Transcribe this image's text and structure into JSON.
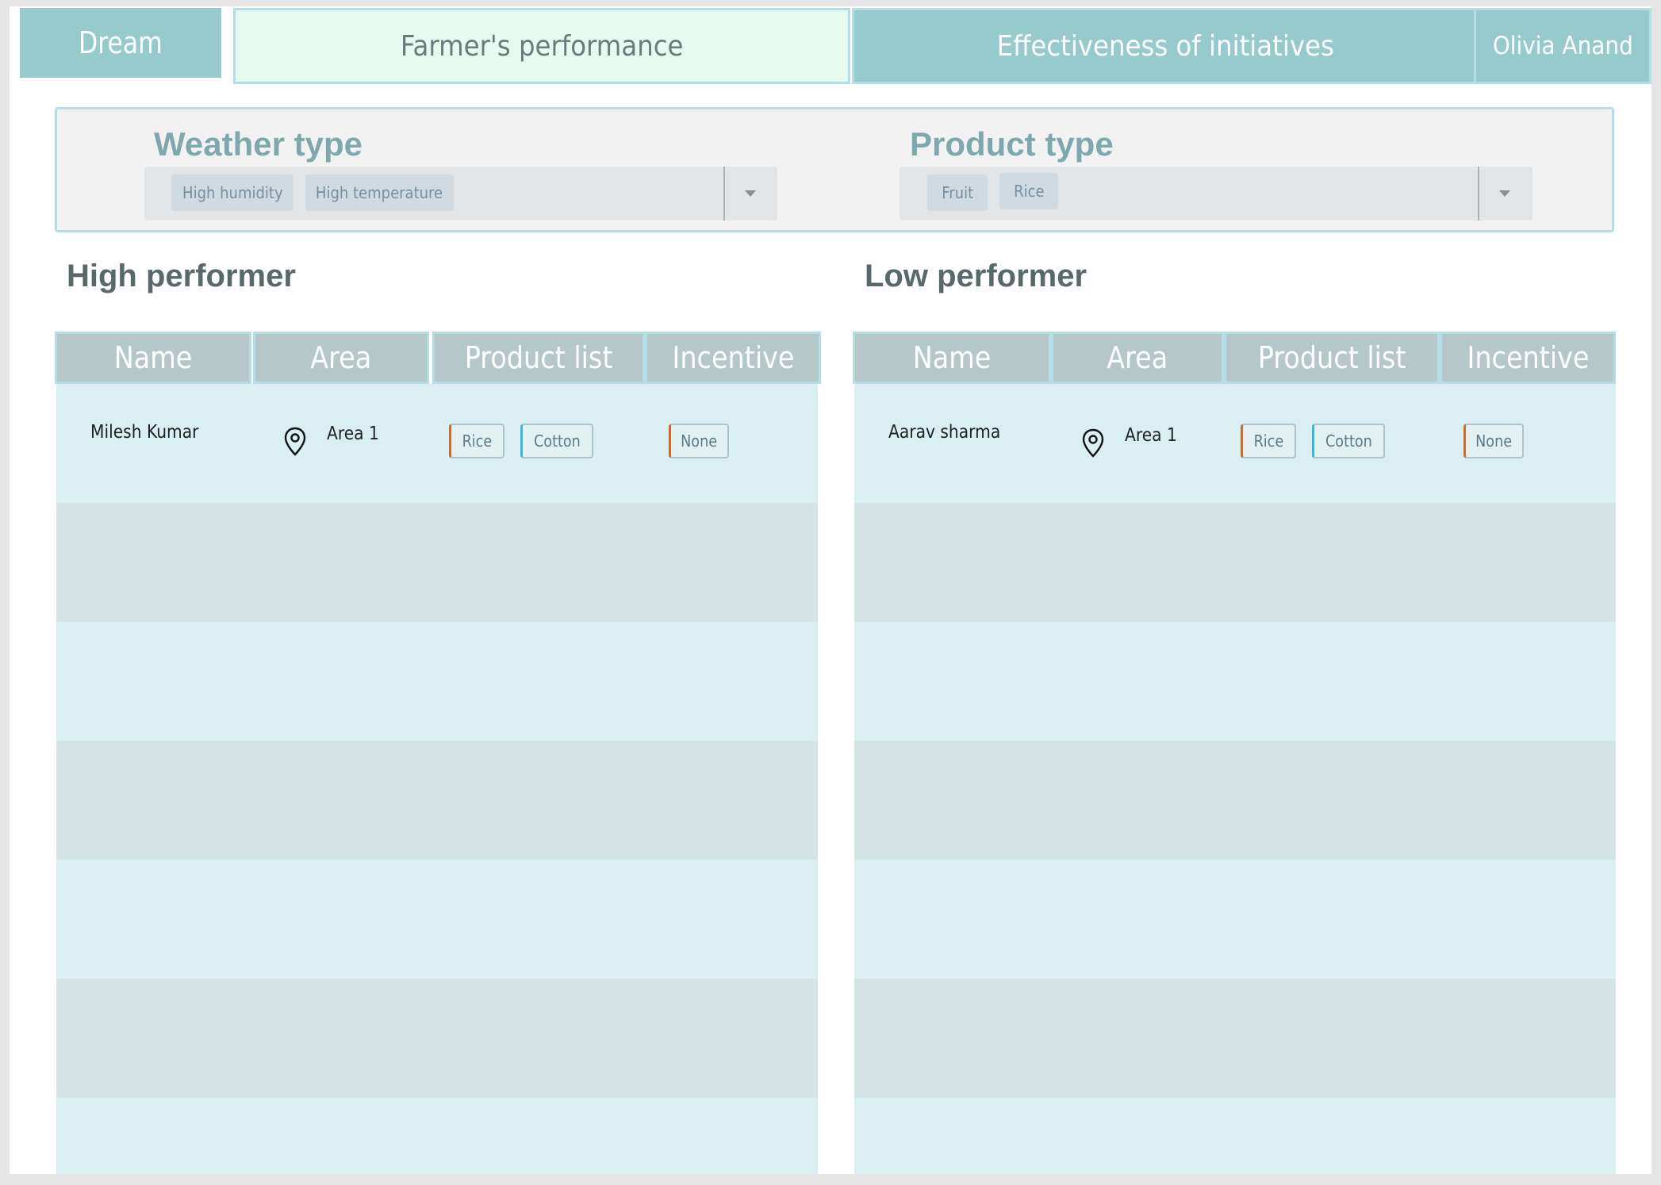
{
  "nav": {
    "brand": "Dream",
    "tabs": [
      {
        "label": "Farmer's performance",
        "active": true
      },
      {
        "label": "Effectiveness of initiatives",
        "active": false
      }
    ],
    "user_name": "Olivia Anand"
  },
  "filters": {
    "weather": {
      "title": "Weather type",
      "selected": [
        "High humidity",
        "High temperature"
      ]
    },
    "product": {
      "title": "Product type",
      "selected": [
        "Fruit",
        "Rice"
      ]
    }
  },
  "high_performer": {
    "title": "High performer",
    "columns": [
      "Name",
      "Area",
      "Product list",
      "Incentive"
    ],
    "rows": [
      {
        "name": "Milesh Kumar",
        "area": "Area 1",
        "products": [
          "Rice",
          "Cotton"
        ],
        "incentive": "None"
      }
    ]
  },
  "low_performer": {
    "title": "Low performer",
    "columns": [
      "Name",
      "Area",
      "Product list",
      "Incentive"
    ],
    "rows": [
      {
        "name": "Aarav sharma",
        "area": "Area 1",
        "products": [
          "Rice",
          "Cotton"
        ],
        "incentive": "None"
      }
    ]
  },
  "colors": {
    "tab_bg": "#96cacd",
    "tab_active_bg": "#e5fbf0",
    "header_bg": "#b5c7c8",
    "row_light": "#daeff1",
    "row_dark": "#d6e3e4",
    "accent_orange": "#cf6a2e",
    "accent_cyan": "#39b9cf"
  },
  "icons": {
    "area": "map-pin-icon",
    "dropdown": "chevron-down-icon"
  }
}
